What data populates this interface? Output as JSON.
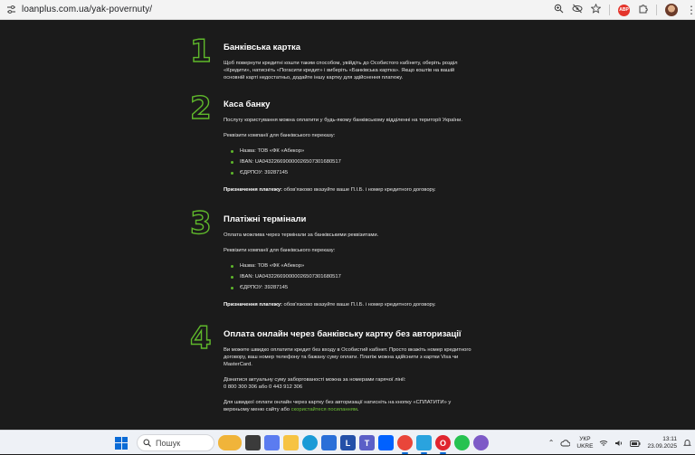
{
  "browser": {
    "url": "loanplus.com.ua/yak-povernuty/",
    "icons": [
      "site-info-icon",
      "zoom-icon",
      "eye-off-icon",
      "star-icon",
      "adblock-icon",
      "extensions-icon",
      "profile-avatar",
      "menu-icon"
    ],
    "adblock_label": "ABP"
  },
  "sections": [
    {
      "number": "1",
      "title": "Банківська картка",
      "paragraph": "Щоб повернути кредитні кошти таким способом, увійдіть до Особистого кабінету, оберіть розділ «Кредити», натисніть «Погасити кредит» і виберіть «Банківська картка». Якщо коштів на вашій основній карті недостатньо, додайте іншу картку для здійснення платежу."
    },
    {
      "number": "2",
      "title": "Каса банку",
      "paragraph": "Послугу користування можна оплатити у будь-якому банківському відділенні на території України.",
      "requisites_label": "Реквізити компанії для банківського переказу:",
      "requisites": [
        "Назва: ТОВ «ФК «Абекор»",
        "IBAN: UA043226690000026507301680517",
        "ЄДРПОУ: 39287145"
      ],
      "purpose_label": "Призначення платежу:",
      "purpose_text": " обов'язково вказуйте ваше П.І.Б. і номер кредитного договору."
    },
    {
      "number": "3",
      "title": "Платіжні термінали",
      "paragraph": "Оплата можлива через термінали за банківськими реквізитами.",
      "requisites_label": "Реквізити компанії для банківського переказу:",
      "requisites": [
        "Назва: ТОВ «ФК «Абекор»",
        "IBAN: UA043226690000026507301680517",
        "ЄДРПОУ: 39287145"
      ],
      "purpose_label": "Призначення платежу:",
      "purpose_text": " обов'язково вказуйте ваше П.І.Б. і номер кредитного договору."
    },
    {
      "number": "4",
      "title": "Оплата онлайн через банківську картку без авторизації",
      "paragraph": "Ви можете швидко оплатити кредит без входу в Особистий кабінет. Просто вкажіть номер кредитного договору, ваш номер телефону та бажану суму оплати. Платіж можна здійснити з картки Visa чи MasterCard.",
      "hotline_text": "Дізнатися актуальну суму заборгованості можна за номерами гарячої лінії:",
      "hotline_numbers": "0 800 300 306 або 0 443 912 306",
      "quick_pay_text": "Для швидкої оплати онлайн через картку без авторизації натисніть на кнопку «СПЛАТИТИ» у верхньому меню сайту або ",
      "quick_pay_link": "скористайтеся посиланням",
      "quick_pay_end": "."
    }
  ],
  "taskbar": {
    "search_placeholder": "Пошук",
    "apps": [
      {
        "name": "weather-widget-icon",
        "color": "#f0b43a",
        "glyph": ""
      },
      {
        "name": "task-view-icon",
        "color": "#3b3b3b",
        "glyph": ""
      },
      {
        "name": "copilot-icon",
        "color": "#5b7cf0",
        "glyph": ""
      },
      {
        "name": "file-explorer-icon",
        "color": "#f6c343",
        "glyph": ""
      },
      {
        "name": "edge-icon",
        "color": "#1a9ad6",
        "glyph": ""
      },
      {
        "name": "store-icon",
        "color": "#2a6fd8",
        "glyph": ""
      },
      {
        "name": "lawrence-app-icon",
        "color": "#2450a8",
        "glyph": "L"
      },
      {
        "name": "teams-icon",
        "color": "#5b5fc7",
        "glyph": "T"
      },
      {
        "name": "dropbox-icon",
        "color": "#0061fe",
        "glyph": ""
      },
      {
        "name": "chrome-icon",
        "color": "#e9453a",
        "glyph": ""
      },
      {
        "name": "telegram-icon",
        "color": "#2aa3de",
        "glyph": ""
      },
      {
        "name": "opera-icon",
        "color": "#e0252f",
        "glyph": "O"
      },
      {
        "name": "whatsapp-icon",
        "color": "#26c251",
        "glyph": ""
      },
      {
        "name": "viber-icon",
        "color": "#7d5ac7",
        "glyph": ""
      }
    ],
    "language_line1": "УКР",
    "language_line2": "UKRE",
    "time": "13:11",
    "date": "23.09.2025"
  }
}
